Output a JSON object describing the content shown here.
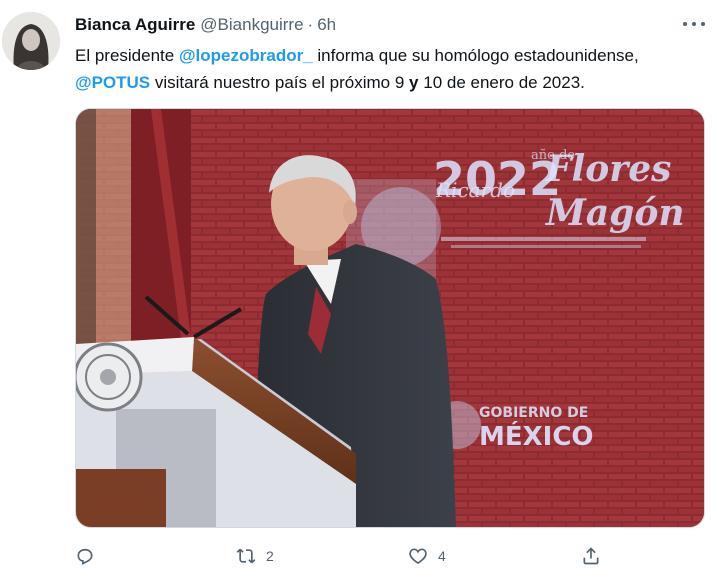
{
  "tweet": {
    "author": {
      "display_name": "Bianca Aguirre",
      "handle": "@Biankguirre",
      "separator": "·",
      "time": "6h"
    },
    "text": {
      "p1": "El presidente ",
      "mention1": "@lopezobrador_",
      "p2": " informa que su homólogo estadounidense,",
      "mention2": "@POTUS",
      "p3": " visitará nuestro país el próximo 9 ",
      "bold_word": "y",
      "p4": " 10 de enero de 2023."
    },
    "media": {
      "banner_year": "2022",
      "banner_name_1": "Ricardo",
      "banner_name_2": "Flores",
      "banner_name_3": "Magón",
      "banner_sub": "año de",
      "gov_line_1": "GOBIERNO DE",
      "gov_line_2": "MÉXICO"
    },
    "actions": {
      "reply": {
        "icon": "reply-icon",
        "count": ""
      },
      "retweet": {
        "icon": "retweet-icon",
        "count": "2"
      },
      "like": {
        "icon": "heart-icon",
        "count": "4"
      },
      "share": {
        "icon": "share-icon",
        "count": ""
      }
    },
    "colors": {
      "mention": "#1d9bf0",
      "secondary_text": "#536471",
      "primary_text": "#0f1419"
    }
  }
}
